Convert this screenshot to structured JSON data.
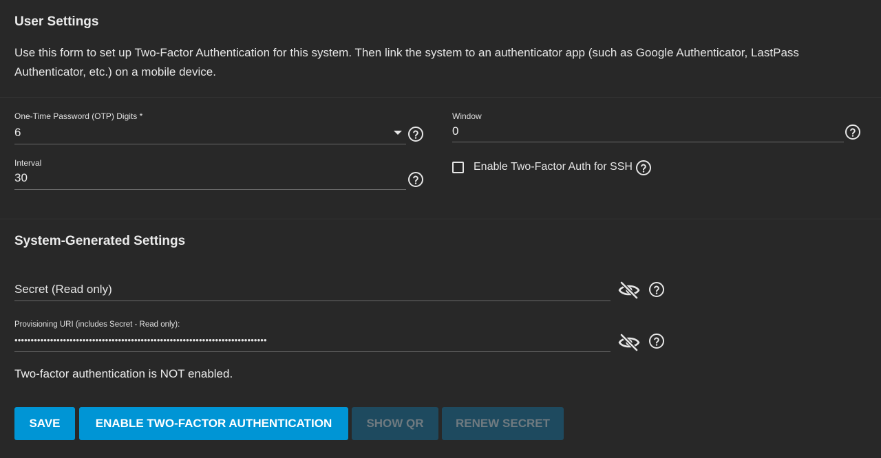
{
  "user_settings": {
    "title": "User Settings",
    "description": "Use this form to set up Two-Factor Authentication for this system. Then link the system to an authenticator app (such as Google Authenticator, LastPass Authenticator, etc.) on a mobile device.",
    "otp_digits": {
      "label": "One-Time Password (OTP) Digits *",
      "value": "6"
    },
    "window": {
      "label": "Window",
      "value": "0"
    },
    "interval": {
      "label": "Interval",
      "value": "30"
    },
    "ssh": {
      "label": "Enable Two-Factor Auth for SSH",
      "checked": false
    }
  },
  "system_settings": {
    "title": "System-Generated Settings",
    "secret": {
      "placeholder": "Secret (Read only)",
      "value": ""
    },
    "provisioning_uri": {
      "label": "Provisioning URI (includes Secret - Read only):",
      "value": "••••••••••••••••••••••••••••••••••••••••••••••••••••••••••••••••••••••••••••••"
    },
    "status": "Two-factor authentication is NOT enabled."
  },
  "buttons": {
    "save": "SAVE",
    "enable": "ENABLE TWO-FACTOR AUTHENTICATION",
    "show_qr": "SHOW QR",
    "renew_secret": "RENEW SECRET"
  },
  "icons": {
    "help": "help-circle-icon",
    "eye_off": "eye-off-icon",
    "dropdown": "caret-down-icon"
  },
  "colors": {
    "background": "#282828",
    "primary": "#0095d5",
    "disabled_button": "#1e4a5f",
    "disabled_text": "#6f7a80"
  }
}
